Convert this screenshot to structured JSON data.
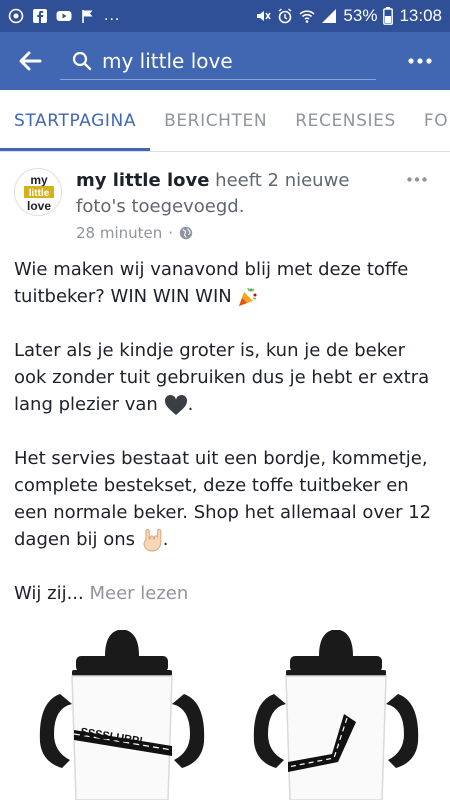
{
  "status_bar": {
    "battery_percent": "53%",
    "time": "13:08",
    "more": "..."
  },
  "app_bar": {
    "search_value": "my little love"
  },
  "tabs": [
    {
      "label": "STARTPAGINA",
      "active": true
    },
    {
      "label": "BERICHTEN",
      "active": false
    },
    {
      "label": "RECENSIES",
      "active": false
    },
    {
      "label": "FO",
      "active": false
    }
  ],
  "post": {
    "author": "my little love",
    "action": "heeft 2 nieuwe foto's toegevoegd.",
    "time": "28 minuten",
    "avatar_text": {
      "line1": "my",
      "line2": "little",
      "line3": "love"
    },
    "paragraphs": [
      "Wie maken wij vanavond blij met deze toffe tuitbeker? WIN WIN WIN",
      "Later als je kindje groter is, kun je de beker ook zonder tuit gebruiken dus je hebt er extra lang plezier van",
      "Het servies bestaat uit een bordje, kommetje, complete bestekset, deze toffe tuitbeker en een normale beker. Shop het allemaal over 12 dagen bij ons"
    ],
    "truncated_text": "Wij zij...",
    "read_more": "Meer lezen",
    "image_cup_text": "SSSSLURP!"
  },
  "colors": {
    "status_bar": "#2f4f96",
    "app_bar": "#4267b2",
    "accent": "#4267b2"
  }
}
